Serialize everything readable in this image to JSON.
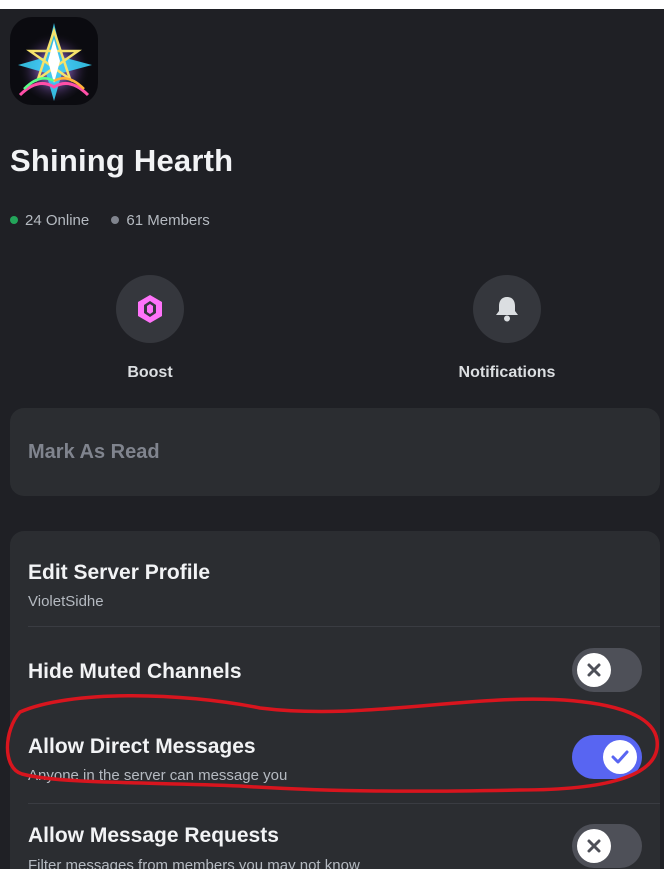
{
  "server": {
    "name": "Shining Hearth",
    "icon": "star-emblem-icon",
    "online": "24 Online",
    "members": "61 Members"
  },
  "actions": [
    {
      "label": "Boost",
      "icon": "boost-gem-icon",
      "accent": "#ff73fa"
    },
    {
      "label": "Notifications",
      "icon": "bell-icon"
    }
  ],
  "mark_read": {
    "label": "Mark As Read"
  },
  "settings": {
    "edit_profile": {
      "title": "Edit Server Profile",
      "subtitle": "VioletSidhe"
    },
    "hide_muted": {
      "title": "Hide Muted Channels",
      "enabled": false
    },
    "allow_dms": {
      "title": "Allow Direct Messages",
      "subtitle": "Anyone in the server can message you",
      "enabled": true
    },
    "allow_requests": {
      "title": "Allow Message Requests",
      "subtitle": "Filter messages from members you may not know",
      "enabled": false
    }
  },
  "colors": {
    "background": "#1f2025",
    "card": "#2b2d31",
    "online": "#23a55a",
    "toggle_on": "#5865f2",
    "toggle_off": "#4e5058",
    "annotation": "#d8151e"
  }
}
